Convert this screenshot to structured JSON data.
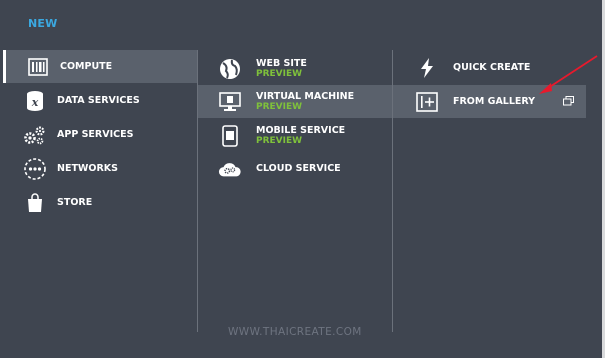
{
  "header": {
    "new_label": "NEW"
  },
  "left_menu": {
    "items": [
      {
        "label": "COMPUTE",
        "icon": "compute-icon",
        "selected": true
      },
      {
        "label": "DATA SERVICES",
        "icon": "data-services-icon"
      },
      {
        "label": "APP SERVICES",
        "icon": "gears-icon"
      },
      {
        "label": "NETWORKS",
        "icon": "network-icon"
      },
      {
        "label": "STORE",
        "icon": "shopping-bag-icon"
      }
    ]
  },
  "middle_menu": {
    "items": [
      {
        "label": "WEB SITE",
        "badge": "PREVIEW",
        "icon": "globe-icon"
      },
      {
        "label": "VIRTUAL MACHINE",
        "badge": "PREVIEW",
        "icon": "monitor-icon",
        "selected": true
      },
      {
        "label": "MOBILE SERVICE",
        "badge": "PREVIEW",
        "icon": "phone-icon"
      },
      {
        "label": "CLOUD SERVICE",
        "badge": "",
        "icon": "cloud-gear-icon"
      }
    ]
  },
  "right_menu": {
    "items": [
      {
        "label": "QUICK CREATE",
        "icon": "lightning-icon"
      },
      {
        "label": "FROM GALLERY",
        "icon": "gallery-plus-icon",
        "selected": true,
        "trailing_icon": "popout-window-icon"
      }
    ]
  },
  "watermark": {
    "text": "WWW.THAICREATE.COM"
  },
  "colors": {
    "background": "#3f4550",
    "selected": "#5a616c",
    "accent": "#3ba8e0",
    "preview": "#7fc13b",
    "arrow": "#e8192c"
  }
}
